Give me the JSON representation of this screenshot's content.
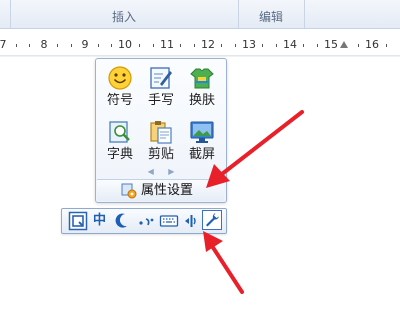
{
  "ribbon": {
    "groups": [
      {
        "label": "插入"
      },
      {
        "label": "编辑"
      }
    ]
  },
  "ruler": {
    "numbers": [
      "7",
      "8",
      "9",
      "10",
      "11",
      "12",
      "13",
      "14",
      "15",
      "16"
    ]
  },
  "palette": {
    "tools": [
      {
        "label": "符号",
        "icon": "smiley-icon"
      },
      {
        "label": "手写",
        "icon": "handwriting-icon"
      },
      {
        "label": "换肤",
        "icon": "skin-shirt-icon"
      },
      {
        "label": "字典",
        "icon": "dictionary-icon"
      },
      {
        "label": "剪贴",
        "icon": "clipboard-icon"
      },
      {
        "label": "截屏",
        "icon": "screenshot-icon"
      }
    ],
    "pager": {
      "prev": "◀",
      "next": "▶"
    },
    "properties_label": "属性设置"
  },
  "statusbar": {
    "mode_label": "中"
  },
  "colors": {
    "accent": "#1d5fb4",
    "annotation_arrow": "#e8202a",
    "panel_border": "#9db2cf"
  }
}
